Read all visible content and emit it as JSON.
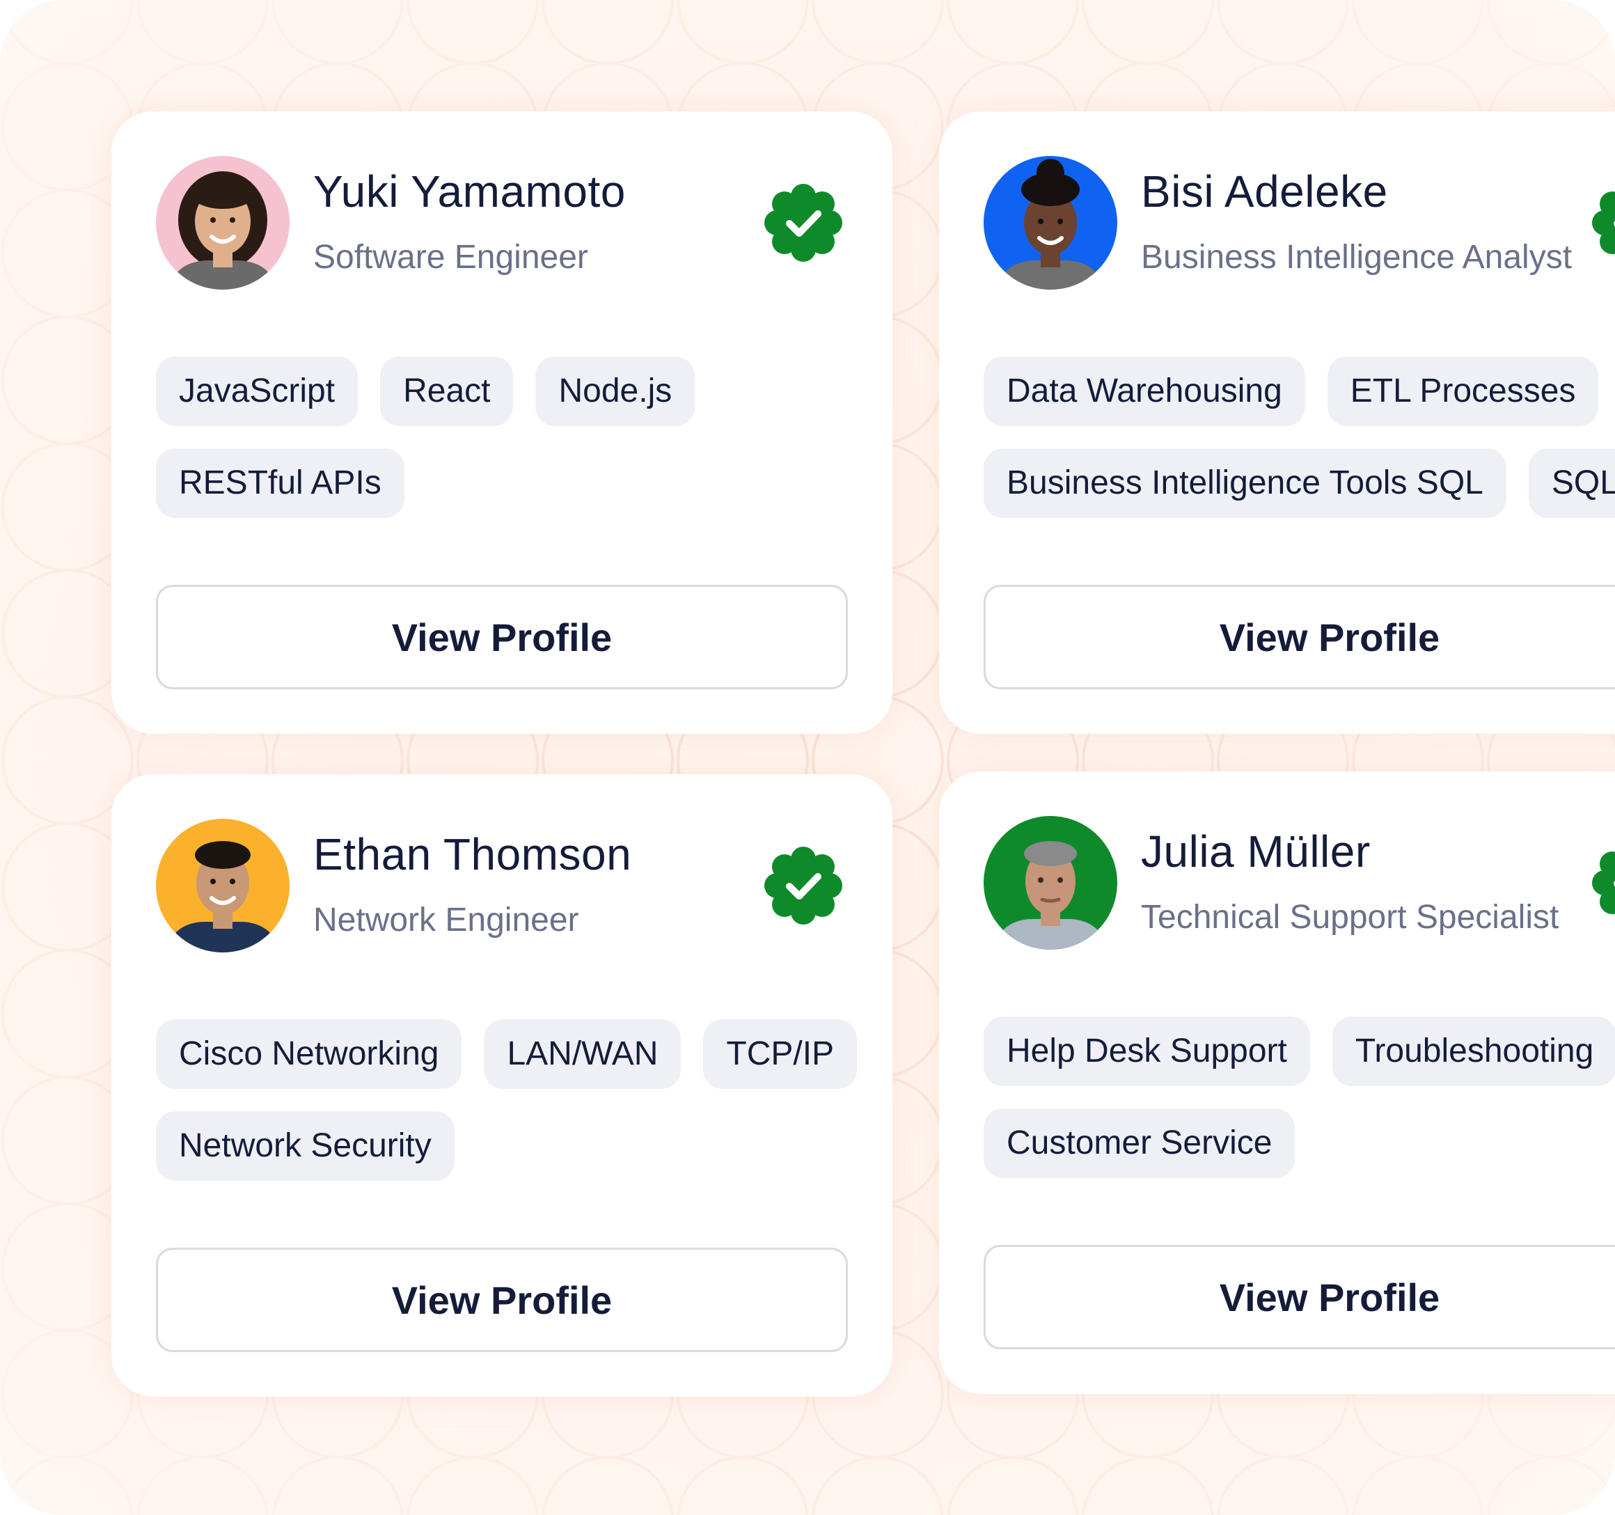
{
  "cards": [
    {
      "name": "Yuki Yamamoto",
      "role": "Software Engineer",
      "avatar_bg": "#f6c2cf",
      "skin": "#e0b08c",
      "hair": "#2a1b14",
      "shirt": "#6a6a6a",
      "verified": true,
      "tags": [
        "JavaScript",
        "React",
        "Node.js",
        "RESTful APIs"
      ],
      "button_label": "View Profile"
    },
    {
      "name": "Bisi Adeleke",
      "role": "Business Intelligence Analyst",
      "avatar_bg": "#0f63f0",
      "skin": "#6b4330",
      "hair": "#161010",
      "shirt": "#707070",
      "verified": true,
      "tags": [
        "Data Warehousing",
        "ETL Processes",
        "Business Intelligence Tools SQL",
        "SQL"
      ],
      "button_label": "View Profile"
    },
    {
      "name": "Ethan Thomson",
      "role": "Network Engineer",
      "avatar_bg": "#fbb12c",
      "skin": "#c99874",
      "hair": "#1b1512",
      "shirt": "#1e3557",
      "verified": true,
      "tags": [
        "Cisco Networking",
        "LAN/WAN",
        "TCP/IP",
        "Network Security"
      ],
      "button_label": "View Profile"
    },
    {
      "name": "Julia Müller",
      "role": "Technical Support Specialist",
      "avatar_bg": "#0f8a2b",
      "skin": "#c7957a",
      "hair": "#8a8a8a",
      "shirt": "#aeb7c4",
      "verified": true,
      "tags": [
        "Help Desk Support",
        "Troubleshooting",
        "Customer Service"
      ],
      "button_label": "View Profile"
    }
  ],
  "colors": {
    "background": "#fff4ee",
    "pattern": "#fbe0d6",
    "card": "#ffffff",
    "tag_bg": "#eff0f5",
    "text_primary": "#141c3a",
    "text_secondary": "#6b7089",
    "verified": "#0f8a2b"
  },
  "icons": {
    "verified": "verified-check-badge-icon"
  }
}
